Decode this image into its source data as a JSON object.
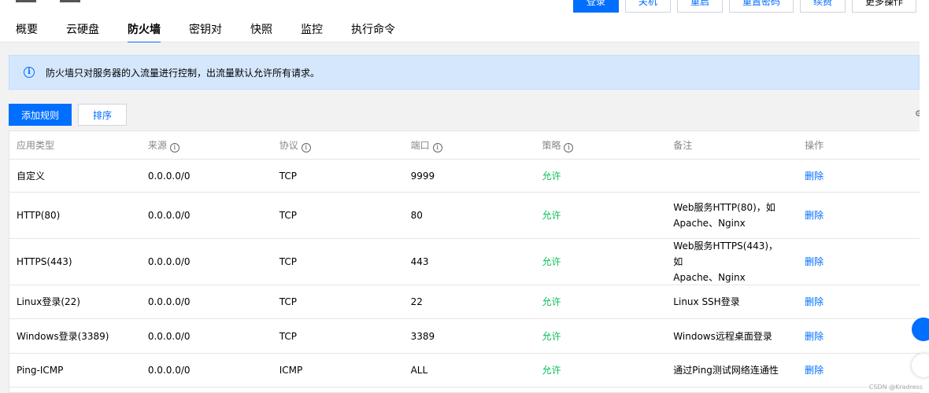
{
  "header": {
    "actions": [
      "登录",
      "关机",
      "重启",
      "重置密码",
      "续费",
      "更多操作"
    ]
  },
  "tabs": [
    {
      "label": "概要",
      "active": false
    },
    {
      "label": "云硬盘",
      "active": false
    },
    {
      "label": "防火墙",
      "active": true
    },
    {
      "label": "密钥对",
      "active": false
    },
    {
      "label": "快照",
      "active": false
    },
    {
      "label": "监控",
      "active": false
    },
    {
      "label": "执行命令",
      "active": false
    }
  ],
  "info": {
    "icon": "info-icon",
    "text": "防火墙只对服务器的入流量进行控制，出流量默认允许所有请求。"
  },
  "toolbar": {
    "add_rule": "添加规则",
    "sort": "排序"
  },
  "table": {
    "columns": [
      "应用类型",
      "来源",
      "协议",
      "端口",
      "策略",
      "备注",
      "操作"
    ],
    "rows": [
      {
        "type": "自定义",
        "source": "0.0.0.0/0",
        "protocol": "TCP",
        "port": "9999",
        "policy": "允许",
        "note1": "",
        "note2": "",
        "action": "删除"
      },
      {
        "type": "HTTP(80)",
        "source": "0.0.0.0/0",
        "protocol": "TCP",
        "port": "80",
        "policy": "允许",
        "note1": "Web服务HTTP(80)，如",
        "note2": "Apache、Nginx",
        "action": "删除"
      },
      {
        "type": "HTTPS(443)",
        "source": "0.0.0.0/0",
        "protocol": "TCP",
        "port": "443",
        "policy": "允许",
        "note1": "Web服务HTTPS(443)，如",
        "note2": "Apache、Nginx",
        "action": "删除"
      },
      {
        "type": "Linux登录(22)",
        "source": "0.0.0.0/0",
        "protocol": "TCP",
        "port": "22",
        "policy": "允许",
        "note1": "Linux SSH登录",
        "note2": "",
        "action": "删除"
      },
      {
        "type": "Windows登录(3389)",
        "source": "0.0.0.0/0",
        "protocol": "TCP",
        "port": "3389",
        "policy": "允许",
        "note1": "Windows远程桌面登录",
        "note2": "",
        "action": "删除"
      },
      {
        "type": "Ping-ICMP",
        "source": "0.0.0.0/0",
        "protocol": "ICMP",
        "port": "ALL",
        "policy": "允许",
        "note1": "通过Ping测试网络连通性",
        "note2": "",
        "action": "删除"
      }
    ]
  },
  "watermark": "CSDN @Kradress",
  "colors": {
    "primary": "#006eff",
    "allow": "#0abf5b",
    "info_bg": "#d5e7fd"
  }
}
